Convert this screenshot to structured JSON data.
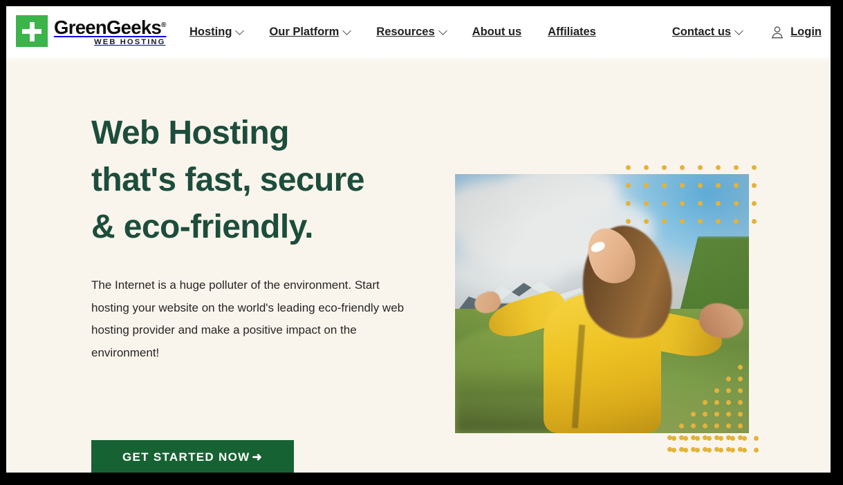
{
  "brand": {
    "logo_icon": "green-plus-square-icon",
    "name": "GreenGeeks",
    "registered_mark": "®",
    "tagline": "WEB HOSTING",
    "logo_green": "#3bb44a"
  },
  "nav": {
    "items": [
      {
        "label": "Hosting",
        "has_dropdown": true
      },
      {
        "label": "Our Platform",
        "has_dropdown": true
      },
      {
        "label": "Resources",
        "has_dropdown": true
      },
      {
        "label": "About us",
        "has_dropdown": false
      },
      {
        "label": "Affiliates",
        "has_dropdown": false
      }
    ],
    "right": [
      {
        "label": "Contact us",
        "has_dropdown": true,
        "icon": null
      },
      {
        "label": "Login",
        "has_dropdown": false,
        "icon": "user-icon"
      }
    ]
  },
  "hero": {
    "title_lines": [
      "Web Hosting",
      "that's fast, secure",
      "& eco-friendly."
    ],
    "title_color": "#1d4d3c",
    "paragraph": "The Internet is a huge polluter of the environment. Start hosting your website on the world's leading eco-friendly web hosting provider and make a positive impact on the environment!",
    "cta": {
      "label": "GET STARTED NOW",
      "arrow": "➜",
      "background": "#176233",
      "text_color": "#ffffff"
    },
    "image": {
      "alt": "Woman in a yellow jacket with arms outstretched in a green mountain landscape",
      "decoration_color": "#e3b33a"
    }
  },
  "page": {
    "background": "#faf5ec",
    "header_background": "#ffffff"
  }
}
